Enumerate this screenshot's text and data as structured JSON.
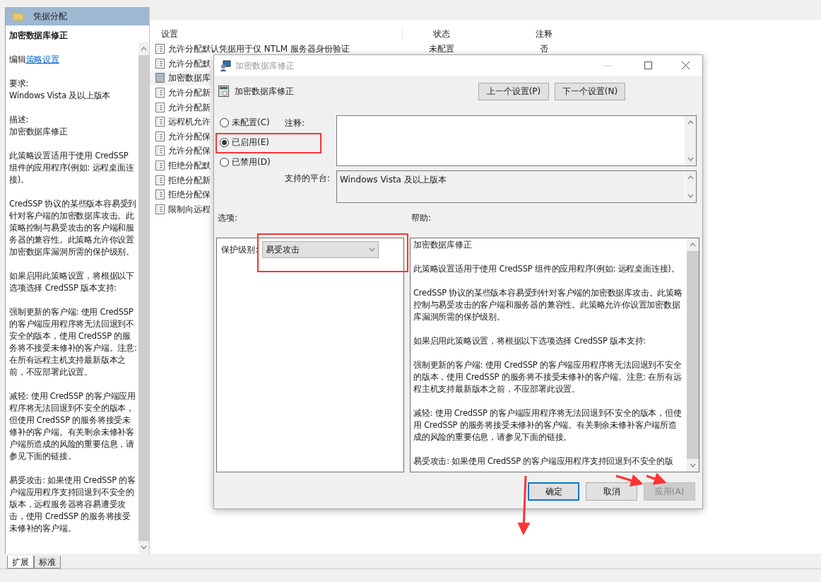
{
  "left_panel": {
    "header": "凭据分配",
    "title": "加密数据库修正",
    "edit_prefix": "编辑",
    "edit_link": "策略设置",
    "sections": [
      {
        "lines": [
          "要求:",
          "Windows Vista 及以上版本"
        ]
      },
      {
        "lines": [
          "描述:",
          "加密数据库修正"
        ]
      },
      {
        "lines": [
          "此策略设置适用于使用 CredSSP 组件的应用程序(例如: 远程桌面连接)。"
        ]
      },
      {
        "lines": [
          "CredSSP 协议的某些版本容易受到针对客户端的加密数据库攻击。此策略控制与易受攻击的客户端和服务器的兼容性。此策略允许你设置加密数据库漏洞所需的保护级别。"
        ]
      },
      {
        "lines": [
          "如果启用此策略设置，将根据以下选项选择 CredSSP 版本支持:"
        ]
      },
      {
        "lines": [
          "强制更新的客户端: 使用 CredSSP 的客户端应用程序将无法回退到不安全的版本，使用 CredSSP 的服务将不接受未修补的客户端。注意: 在所有远程主机支持最新版本之前，不应部署此设置。"
        ]
      },
      {
        "lines": [
          "减轻: 使用 CredSSP 的客户端应用程序将无法回退到不安全的版本，但使用 CredSSP 的服务将接受未修补的客户端。有关剩余未修补客户端所造成的风险的重要信息，请参见下面的链接。"
        ]
      },
      {
        "lines": [
          "易受攻击: 如果使用 CredSSP 的客户端应用程序支持回退到不安全的版本，远程服务器将容易遭受攻击，使用 CredSSP 的服务将接受未修补的客户端。"
        ]
      }
    ],
    "tabs": [
      {
        "label": "扩展",
        "selected": true
      },
      {
        "label": "标准",
        "selected": false
      }
    ]
  },
  "table": {
    "columns": [
      "设置",
      "状态",
      "注释"
    ],
    "rows": [
      {
        "name": "允许分配默认凭据用于仅 NTLM 服务器身份验证",
        "status": "未配置",
        "comment": "否",
        "selected": false
      },
      {
        "name": "允许分配默",
        "selected": false
      },
      {
        "name": "加密数据库",
        "selected": true
      },
      {
        "name": "允许分配新",
        "selected": false
      },
      {
        "name": "允许分配新",
        "selected": false
      },
      {
        "name": "远程机允许",
        "selected": false
      },
      {
        "name": "允许分配保",
        "selected": false
      },
      {
        "name": "允许分配保",
        "selected": false
      },
      {
        "name": "拒绝分配默",
        "selected": false
      },
      {
        "name": "拒绝分配新",
        "selected": false
      },
      {
        "name": "拒绝分配保",
        "selected": false
      },
      {
        "name": "限制向远程",
        "selected": false
      }
    ]
  },
  "dialog": {
    "title": "加密数据库修正",
    "policy_title": "加密数据库修正",
    "prev_button": "上一个设置(P)",
    "next_button": "下一个设置(N)",
    "radios": [
      {
        "label": "未配置(C)",
        "selected": false
      },
      {
        "label": "已启用(E)",
        "selected": true
      },
      {
        "label": "已禁用(D)",
        "selected": false
      }
    ],
    "comment_label": "注释:",
    "platform_label": "支持的平台:",
    "platform_value": "Windows Vista 及以上版本",
    "options_label": "选项:",
    "help_label": "帮助:",
    "option": {
      "label": "保护级别:",
      "value": "易受攻击"
    },
    "help_paragraphs": [
      "加密数据库修正",
      "此策略设置适用于使用 CredSSP 组件的应用程序(例如: 远程桌面连接)。",
      "CredSSP 协议的某些版本容易受到针对客户端的加密数据库攻击。此策略控制与易受攻击的客户端和服务器的兼容性。此策略允许你设置加密数据库漏洞所需的保护级别。",
      "如果启用此策略设置，将根据以下选项选择 CredSSP 版本支持:",
      "强制更新的客户端: 使用 CredSSP 的客户端应用程序将无法回退到不安全的版本，使用 CredSSP 的服务将不接受未修补的客户端。注意: 在所有远程主机支持最新版本之前，不应部署此设置。",
      "减轻: 使用 CredSSP 的客户端应用程序将无法回退到不安全的版本，但使用 CredSSP 的服务将接受未修补的客户端。有关剩余未修补客户端所造成的风险的重要信息，请参见下面的链接。",
      "易受攻击: 如果使用 CredSSP 的客户端应用程序支持回退到不安全的版"
    ],
    "buttons": [
      {
        "label": "确定",
        "kind": "default"
      },
      {
        "label": "取消",
        "kind": "normal"
      },
      {
        "label": "应用(A)",
        "kind": "disabled"
      }
    ]
  }
}
